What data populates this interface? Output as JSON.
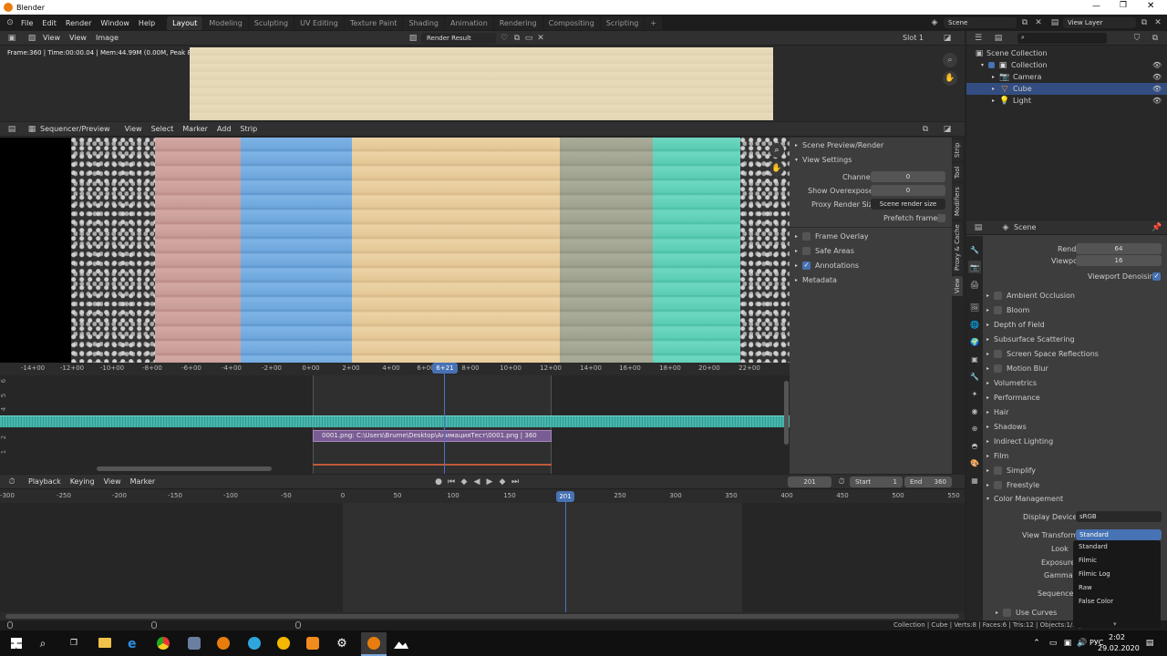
{
  "app": {
    "title": "Blender"
  },
  "menu": [
    "File",
    "Edit",
    "Render",
    "Window",
    "Help"
  ],
  "workspaces": [
    {
      "label": "Layout",
      "active": true
    },
    {
      "label": "Modeling"
    },
    {
      "label": "Sculpting"
    },
    {
      "label": "UV Editing"
    },
    {
      "label": "Texture Paint"
    },
    {
      "label": "Shading"
    },
    {
      "label": "Animation"
    },
    {
      "label": "Rendering"
    },
    {
      "label": "Compositing"
    },
    {
      "label": "Scripting"
    },
    {
      "label": "+"
    }
  ],
  "scene": {
    "name": "Scene",
    "view_layer": "View Layer"
  },
  "image_editor": {
    "menus": [
      "View",
      "View",
      "Image"
    ],
    "image_name": "Render Result",
    "slot": "Slot 1",
    "info": "Frame:360 | Time:00:00.04 | Mem:44.99M (0.00M, Peak 82.97M)"
  },
  "sequencer": {
    "mode": "Sequencer/Preview",
    "menus": [
      "View",
      "Select",
      "Marker",
      "Add",
      "Strip"
    ],
    "ticks": [
      "-14+00",
      "-12+00",
      "-10+00",
      "-8+00",
      "-6+00",
      "-4+00",
      "-2+00",
      "0+00",
      "2+00",
      "4+00",
      "6+00",
      "6+21",
      "8+00",
      "10+00",
      "12+00",
      "14+00",
      "16+00",
      "18+00",
      "20+00",
      "22+00"
    ],
    "channels": [
      "6",
      "5",
      "4",
      "3",
      "2",
      "1"
    ],
    "current": "6+21",
    "strip_label": "0001.png: C:\\Users\\Brume\\Desktop\\АнимацияТест\\0001.png | 360"
  },
  "seq_sidebar": {
    "panels": {
      "preview_render": "Scene Preview/Render",
      "view_settings": "View Settings",
      "frame_overlay": "Frame Overlay",
      "safe_areas": "Safe Areas",
      "annotations": "Annotations",
      "metadata": "Metadata"
    },
    "channel_label": "Channel",
    "channel_value": "0",
    "overexposed_label": "Show Overexposed",
    "overexposed_value": "0",
    "proxy_label": "Proxy Render Size",
    "proxy_value": "Scene render size",
    "prefetch_label": "Prefetch frames",
    "tabs": [
      "Strip",
      "Tool",
      "Modifiers",
      "Proxy & Cache",
      "View"
    ]
  },
  "timeline": {
    "menus": [
      "Playback",
      "Keying",
      "View",
      "Marker"
    ],
    "frame": "201",
    "start_label": "Start",
    "start": "1",
    "end_label": "End",
    "end": "360",
    "ticks": [
      "-300",
      "-250",
      "-200",
      "-150",
      "-100",
      "-50",
      "0",
      "50",
      "100",
      "150",
      "201",
      "250",
      "300",
      "350",
      "400",
      "450",
      "500",
      "550"
    ]
  },
  "outliner": {
    "root": "Scene Collection",
    "items": [
      {
        "label": "Collection",
        "level": 1
      },
      {
        "label": "Camera",
        "level": 2
      },
      {
        "label": "Cube",
        "level": 2,
        "selected": true
      },
      {
        "label": "Light",
        "level": 2
      }
    ]
  },
  "properties": {
    "scene_label": "Scene",
    "render_label": "Render",
    "render_value": "64",
    "viewport_label": "Viewport",
    "viewport_value": "16",
    "denoise_label": "Viewport Denoising",
    "sections": [
      {
        "label": "Ambient Occlusion",
        "cb": true
      },
      {
        "label": "Bloom",
        "cb": true
      },
      {
        "label": "Depth of Field"
      },
      {
        "label": "Subsurface Scattering"
      },
      {
        "label": "Screen Space Reflections",
        "cb": true
      },
      {
        "label": "Motion Blur",
        "cb": true
      },
      {
        "label": "Volumetrics"
      },
      {
        "label": "Performance"
      },
      {
        "label": "Hair"
      },
      {
        "label": "Shadows"
      },
      {
        "label": "Indirect Lighting"
      },
      {
        "label": "Film"
      },
      {
        "label": "Simplify",
        "cb": true
      },
      {
        "label": "Freestyle",
        "cb": true
      }
    ],
    "color_mgmt": "Color Management",
    "display_device_label": "Display Device",
    "display_device": "sRGB",
    "view_transform_label": "View Transform",
    "view_transform": "Standard",
    "look_label": "Look",
    "exposure_label": "Exposure",
    "gamma_label": "Gamma",
    "sequencer_label": "Sequencer",
    "use_curves": "Use Curves",
    "dropdown": [
      "Standard",
      "Filmic",
      "Filmic Log",
      "Raw",
      "False Color"
    ]
  },
  "statusbar": {
    "text": "Collection | Cube | Verts:8 | Faces:6 | Tris:12 | Objects:1/3 |"
  },
  "taskbar": {
    "lang": "РУС",
    "time": "2:02",
    "date": "29.02.2020"
  },
  "colors": {
    "accent": "#4772b3",
    "header": "#303030",
    "panel": "#3d3d3d",
    "playhead": "#4b73c4"
  }
}
